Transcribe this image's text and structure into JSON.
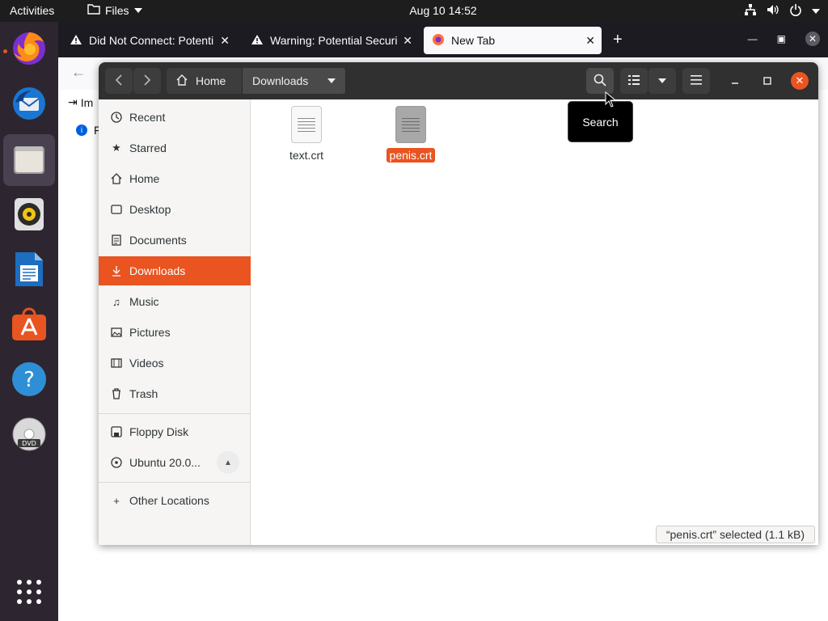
{
  "topbar": {
    "activities": "Activities",
    "app_menu_label": "Files",
    "clock": "Aug 10  14:52",
    "tray_icons": [
      "network-icon",
      "volume-icon",
      "power-icon"
    ]
  },
  "dock": {
    "items": [
      {
        "name": "firefox",
        "icon": "firefox-icon",
        "running": true
      },
      {
        "name": "thunderbird",
        "icon": "thunderbird-icon",
        "running": false
      },
      {
        "name": "files",
        "icon": "files-icon",
        "running": true,
        "active": true
      },
      {
        "name": "rhythmbox",
        "icon": "rhythmbox-icon",
        "running": false
      },
      {
        "name": "libreoffice-writer",
        "icon": "writer-icon",
        "running": false
      },
      {
        "name": "software",
        "icon": "software-icon",
        "running": false
      },
      {
        "name": "help",
        "icon": "help-icon",
        "running": false
      },
      {
        "name": "dvd",
        "icon": "dvd-icon",
        "running": false
      },
      {
        "name": "show-apps",
        "icon": "grid-icon",
        "running": false
      }
    ]
  },
  "firefox": {
    "tabs": [
      {
        "title": "Did Not Connect: Potenti",
        "icon": "warning-icon"
      },
      {
        "title": "Warning: Potential Securi",
        "icon": "warning-icon"
      },
      {
        "title": "New Tab",
        "icon": "firefox-icon",
        "current": true
      }
    ],
    "new_tab_symbol": "+",
    "import_label": "Im",
    "info_label": "F"
  },
  "files": {
    "path": [
      {
        "label": "Home",
        "icon": "home-icon"
      },
      {
        "label": "Downloads",
        "current": true
      }
    ],
    "sidebar": {
      "places": [
        {
          "label": "Recent",
          "icon": "clock-icon"
        },
        {
          "label": "Starred",
          "icon": "star-icon"
        },
        {
          "label": "Home",
          "icon": "home-icon"
        },
        {
          "label": "Desktop",
          "icon": "desktop-icon"
        },
        {
          "label": "Documents",
          "icon": "documents-icon"
        },
        {
          "label": "Downloads",
          "icon": "downloads-icon",
          "selected": true
        },
        {
          "label": "Music",
          "icon": "music-icon"
        },
        {
          "label": "Pictures",
          "icon": "pictures-icon"
        },
        {
          "label": "Videos",
          "icon": "videos-icon"
        },
        {
          "label": "Trash",
          "icon": "trash-icon"
        }
      ],
      "devices": [
        {
          "label": "Floppy Disk",
          "icon": "floppy-icon"
        },
        {
          "label": "Ubuntu 20.0...",
          "icon": "disc-icon",
          "ejectable": true
        }
      ],
      "other": {
        "label": "Other Locations",
        "icon": "plus-icon"
      }
    },
    "items": [
      {
        "name": "text.crt",
        "selected": false
      },
      {
        "name": "penis.crt",
        "selected": true
      }
    ],
    "status": "“penis.crt” selected  (1.1 kB)",
    "tooltip": "Search"
  },
  "colors": {
    "accent": "#e95420",
    "topbar": "#1d1d1d",
    "dock": "#2d2630",
    "headerbar": "#303030"
  }
}
